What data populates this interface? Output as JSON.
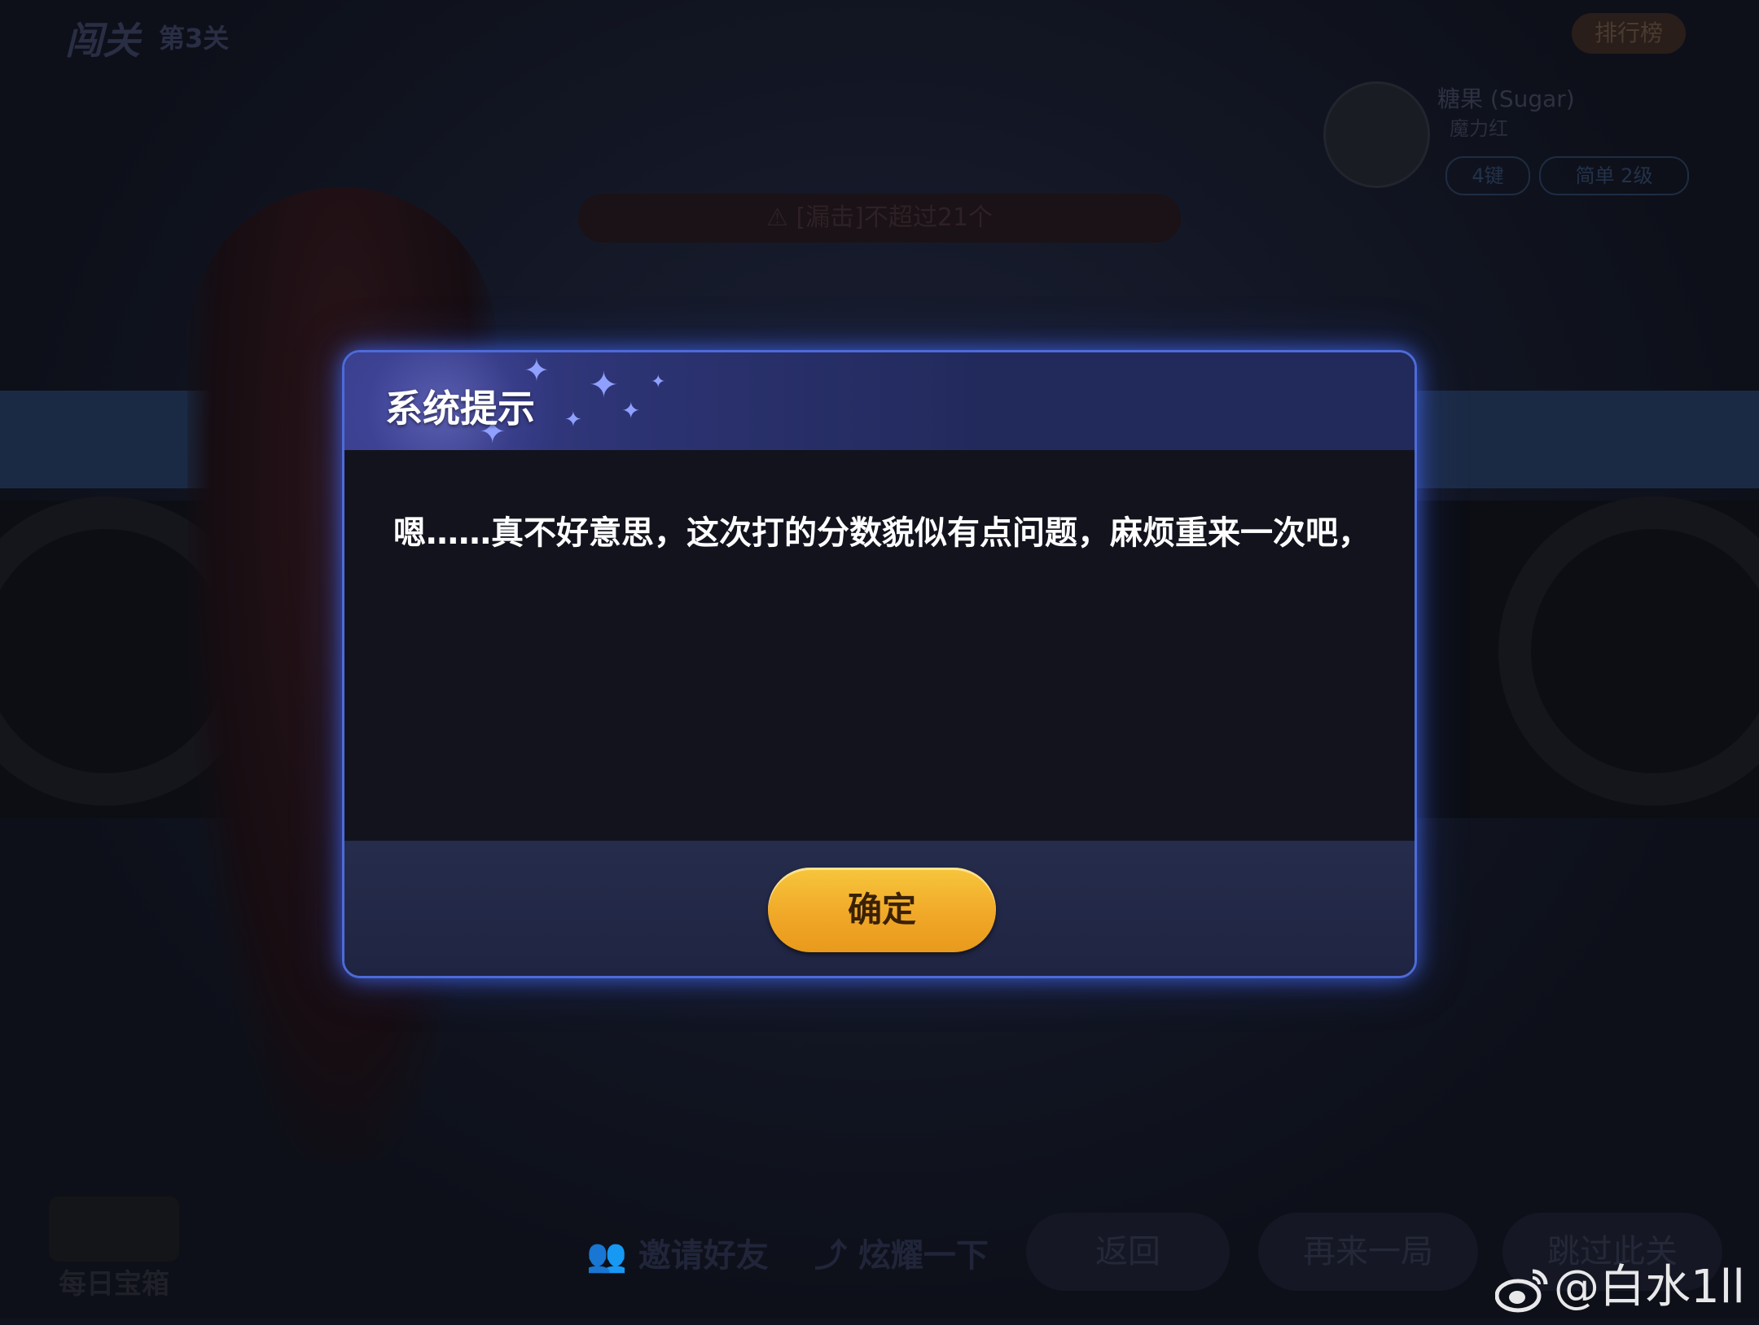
{
  "background": {
    "mode_logo": "闯关",
    "level_label": "第3关",
    "leaderboard_label": "排行榜",
    "song_title": "糖果 (Sugar)",
    "song_artist": "魔力红",
    "keys_badge": "4键",
    "difficulty_badge": "简单   2级",
    "mission_text": "⚠ [漏击]不超过21个",
    "daily_chest_label": "每日宝箱",
    "invite_label": "邀请好友",
    "share_label": "炫耀一下",
    "back_label": "返回",
    "retry_label": "再来一局",
    "skip_label": "跳过此关"
  },
  "dialog": {
    "title": "系统提示",
    "message": "嗯……真不好意思，这次打的分数貌似有点问题，麻烦重来一次吧，",
    "confirm_label": "确定"
  },
  "watermark": {
    "text": "@白水1ll"
  },
  "colors": {
    "dialog_border": "#4d6bd8",
    "button_gold": "#f0a626",
    "header_purple": "#3a3f8e"
  }
}
